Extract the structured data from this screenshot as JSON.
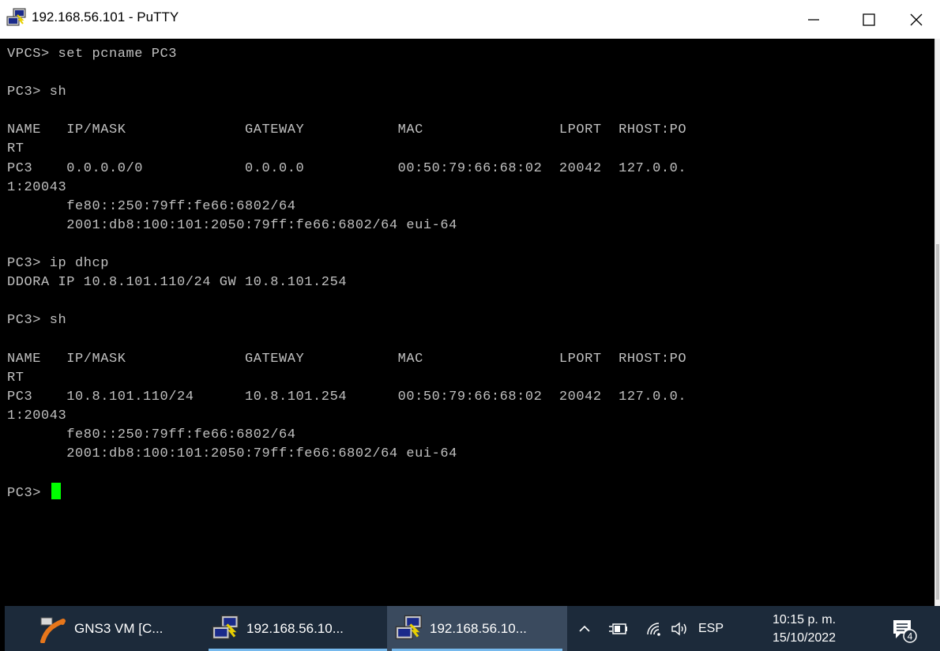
{
  "window": {
    "title": "192.168.56.101 - PuTTY"
  },
  "terminal": {
    "lines": [
      "VPCS> set pcname PC3",
      "",
      "PC3> sh",
      "",
      "NAME   IP/MASK              GATEWAY           MAC                LPORT  RHOST:PO",
      "RT",
      "PC3    0.0.0.0/0            0.0.0.0           00:50:79:66:68:02  20042  127.0.0.",
      "1:20043",
      "       fe80::250:79ff:fe66:6802/64",
      "       2001:db8:100:101:2050:79ff:fe66:6802/64 eui-64",
      "",
      "PC3> ip dhcp",
      "DDORA IP 10.8.101.110/24 GW 10.8.101.254",
      "",
      "PC3> sh",
      "",
      "NAME   IP/MASK              GATEWAY           MAC                LPORT  RHOST:PO",
      "RT",
      "PC3    10.8.101.110/24      10.8.101.254      00:50:79:66:68:02  20042  127.0.0.",
      "1:20043",
      "       fe80::250:79ff:fe66:6802/64",
      "       2001:db8:100:101:2050:79ff:fe66:6802/64 eui-64",
      ""
    ],
    "prompt": "PC3> ",
    "text_color": "#c0c0c0",
    "cursor_color": "#00ff00"
  },
  "taskbar": {
    "items": [
      {
        "label": "GNS3 VM [C...",
        "icon": "gns3-icon"
      },
      {
        "label": "192.168.56.10...",
        "icon": "putty-icon"
      },
      {
        "label": "192.168.56.10...",
        "icon": "putty-icon"
      }
    ],
    "language": "ESP",
    "time": "10:15 p. m.",
    "date": "15/10/2022",
    "notification_count": "4"
  }
}
